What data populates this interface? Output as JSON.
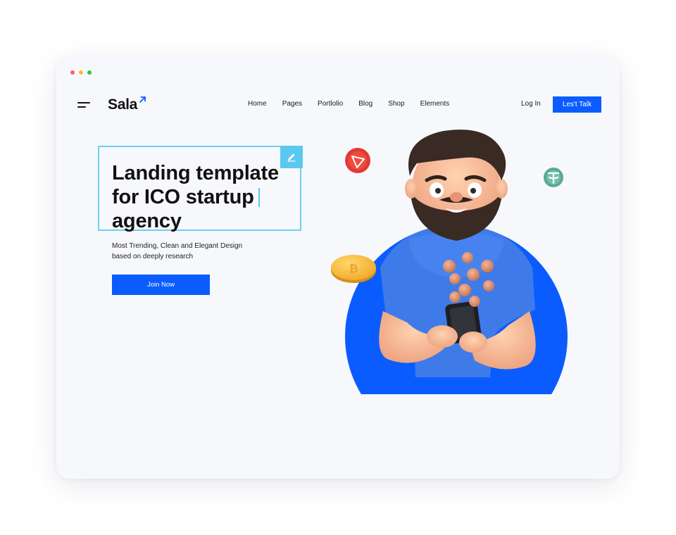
{
  "header": {
    "logo": "Sala",
    "nav": [
      "Home",
      "Pages",
      "Portlolio",
      "Blog",
      "Shop",
      "Elements"
    ],
    "login": "Log In",
    "cta": "Les't Talk"
  },
  "hero": {
    "headline_lines": [
      "Landing template",
      "for ICO startup",
      "agency"
    ],
    "subtitle_lines": [
      "Most Trending, Clean and Elegant Design",
      "based on deeply research"
    ],
    "button": "Join Now"
  },
  "colors": {
    "accent": "#0b5cff",
    "edit_highlight": "#5bc8ef",
    "background": "#f7f8fc"
  },
  "icons": [
    "menu-icon",
    "arrow-up-right-icon",
    "edit-pencil-icon",
    "tron-coin-icon",
    "tether-coin-icon",
    "bitcoin-coin-icon"
  ]
}
